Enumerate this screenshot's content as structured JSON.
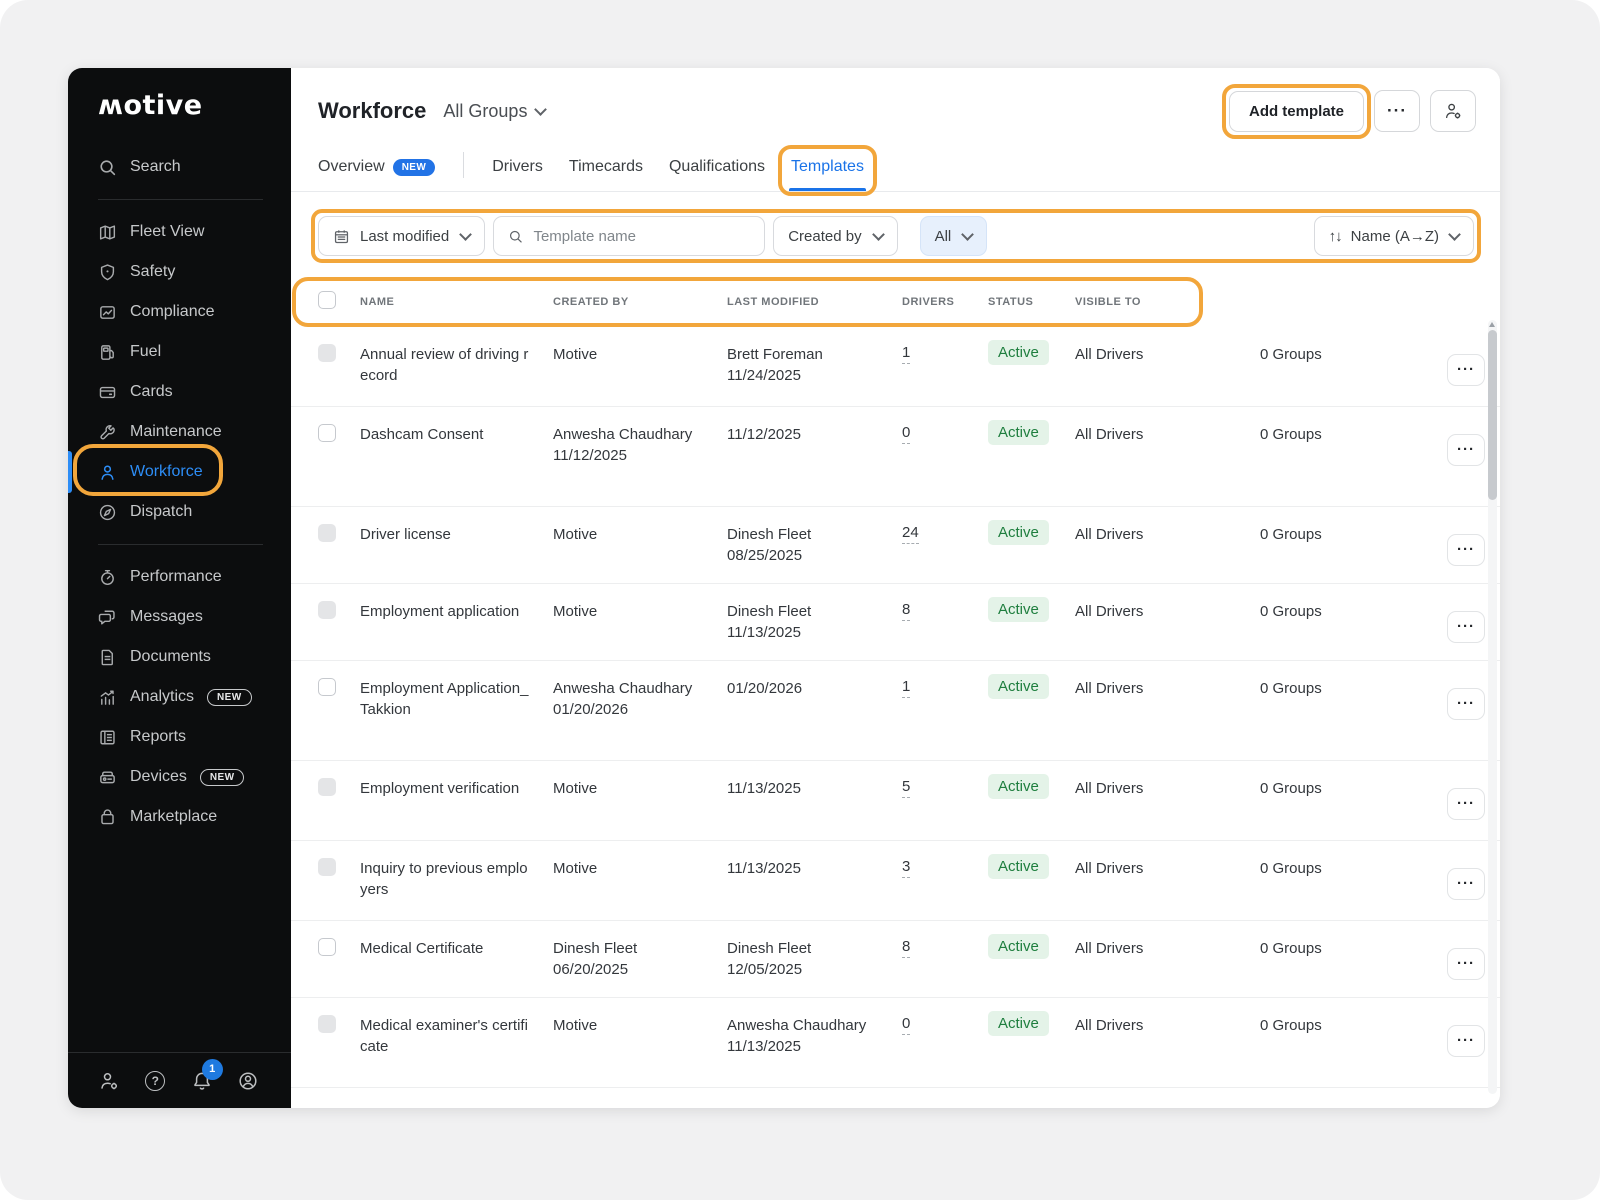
{
  "colors": {
    "accent_blue": "#1A73E8",
    "highlight_orange": "#F2A63B",
    "status_green": "#1E7E3E",
    "status_green_bg": "#E4F3E8",
    "sidebar_bg": "#0C0D0E"
  },
  "brand": {
    "logo_text": "ʍotive"
  },
  "sidebar": {
    "search_label": "Search",
    "items": [
      {
        "label": "Fleet View"
      },
      {
        "label": "Safety"
      },
      {
        "label": "Compliance"
      },
      {
        "label": "Fuel"
      },
      {
        "label": "Cards"
      },
      {
        "label": "Maintenance"
      },
      {
        "label": "Workforce"
      },
      {
        "label": "Dispatch"
      },
      {
        "label": "Performance"
      },
      {
        "label": "Messages"
      },
      {
        "label": "Documents"
      },
      {
        "label": "Analytics",
        "badge": "NEW"
      },
      {
        "label": "Reports"
      },
      {
        "label": "Devices",
        "badge": "NEW"
      },
      {
        "label": "Marketplace"
      }
    ],
    "notification_count": "1"
  },
  "header": {
    "title": "Workforce",
    "group_selector": "All Groups",
    "add_template_label": "Add template",
    "more_label": "···"
  },
  "tabs": {
    "overview": {
      "label": "Overview",
      "badge": "NEW"
    },
    "drivers": {
      "label": "Drivers"
    },
    "timecards": {
      "label": "Timecards"
    },
    "qualifications": {
      "label": "Qualifications"
    },
    "templates": {
      "label": "Templates"
    }
  },
  "filters": {
    "date_filter": "Last modified",
    "search_placeholder": "Template name",
    "created_by": "Created by",
    "status_filter": "All",
    "sort_arrows": "↑↓",
    "sort_label": "Name (A→Z)"
  },
  "table": {
    "columns": {
      "name": "NAME",
      "created_by": "CREATED BY",
      "last_modified": "LAST MODIFIED",
      "drivers": "DRIVERS",
      "status": "STATUS",
      "visible_to": "VISIBLE TO"
    },
    "rows": [
      {
        "name": "Annual review of driving record",
        "created_by": "Motive",
        "created_date": "",
        "modified_by": "Brett Foreman",
        "modified_date": "11/24/2025",
        "drivers": "1",
        "status": "Active",
        "visible_to": "All Drivers",
        "groups": "0 Groups",
        "menu": "···",
        "cb_class": "cb cb-muted"
      },
      {
        "name": "Dashcam Consent",
        "created_by": "Anwesha Chaudhary",
        "created_date": "11/12/2025",
        "modified_by": "",
        "modified_date": "11/12/2025",
        "drivers": "0",
        "status": "Active",
        "visible_to": "All Drivers",
        "groups": "0 Groups",
        "menu": "···",
        "cb_class": "cb"
      },
      {
        "name": "Driver license",
        "created_by": "Motive",
        "created_date": "",
        "modified_by": "Dinesh Fleet",
        "modified_date": "08/25/2025",
        "drivers": "24",
        "status": "Active",
        "visible_to": "All Drivers",
        "groups": "0 Groups",
        "menu": "···",
        "cb_class": "cb cb-muted"
      },
      {
        "name": "Employment application",
        "created_by": "Motive",
        "created_date": "",
        "modified_by": "Dinesh Fleet",
        "modified_date": "11/13/2025",
        "drivers": "8",
        "status": "Active",
        "visible_to": "All Drivers",
        "groups": "0 Groups",
        "menu": "···",
        "cb_class": "cb cb-muted"
      },
      {
        "name": "Employment Application_Takkion",
        "created_by": "Anwesha Chaudhary",
        "created_date": "01/20/2026",
        "modified_by": "",
        "modified_date": "01/20/2026",
        "drivers": "1",
        "status": "Active",
        "visible_to": "All Drivers",
        "groups": "0 Groups",
        "menu": "···",
        "cb_class": "cb"
      },
      {
        "name": "Employment verification",
        "created_by": "Motive",
        "created_date": "",
        "modified_by": "",
        "modified_date": "11/13/2025",
        "drivers": "5",
        "status": "Active",
        "visible_to": "All Drivers",
        "groups": "0 Groups",
        "menu": "···",
        "cb_class": "cb cb-muted"
      },
      {
        "name": "Inquiry to previous employers",
        "created_by": "Motive",
        "created_date": "",
        "modified_by": "",
        "modified_date": "11/13/2025",
        "drivers": "3",
        "status": "Active",
        "visible_to": "All Drivers",
        "groups": "0 Groups",
        "menu": "···",
        "cb_class": "cb cb-muted"
      },
      {
        "name": "Medical Certificate",
        "created_by": "Dinesh Fleet",
        "created_date": "06/20/2025",
        "modified_by": "Dinesh Fleet",
        "modified_date": "12/05/2025",
        "drivers": "8",
        "status": "Active",
        "visible_to": "All Drivers",
        "groups": "0 Groups",
        "menu": "···",
        "cb_class": "cb"
      },
      {
        "name": "Medical examiner's certificate",
        "created_by": "Motive",
        "created_date": "",
        "modified_by": "Anwesha Chaudhary",
        "modified_date": "11/13/2025",
        "drivers": "0",
        "status": "Active",
        "visible_to": "All Drivers",
        "groups": "0 Groups",
        "menu": "···",
        "cb_class": "cb cb-muted"
      }
    ]
  }
}
